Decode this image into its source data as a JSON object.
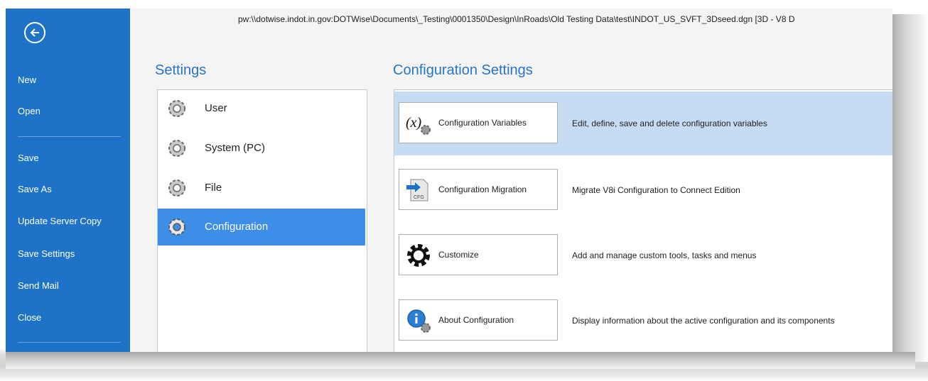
{
  "window_path": "pw:\\\\dotwise.indot.in.gov:DOTWise\\Documents\\_Testing\\0001350\\Design\\InRoads\\Old Testing Data\\test\\INDOT_US_SVFT_3Dseed.dgn [3D - V8 D",
  "nav": {
    "items": [
      "New",
      "Open",
      "Save",
      "Save As",
      "Update Server Copy",
      "Save Settings",
      "Send Mail",
      "Close"
    ]
  },
  "settings": {
    "heading": "Settings",
    "items": [
      "User",
      "System (PC)",
      "File",
      "Configuration"
    ],
    "selected": "Configuration"
  },
  "configuration": {
    "heading": "Configuration Settings",
    "rows": [
      {
        "button": "Configuration Variables",
        "description": "Edit, define, save and delete configuration variables",
        "icon": "configuration-variables-icon"
      },
      {
        "button": "Configuration Migration",
        "description": "Migrate V8i Configuration to Connect Edition",
        "icon": "configuration-migration-icon",
        "icon_text": "CFG"
      },
      {
        "button": "Customize",
        "description": "Add and manage custom tools, tasks and menus",
        "icon": "customize-gear-icon"
      },
      {
        "button": "About Configuration",
        "description": "Display information about the active configuration and its components",
        "icon": "about-info-icon"
      }
    ]
  },
  "colors": {
    "nav_bg": "#1e73c8",
    "accent_text": "#2a74c4",
    "selected_item": "#3d8ee6",
    "selected_row": "#c6dcf3"
  }
}
